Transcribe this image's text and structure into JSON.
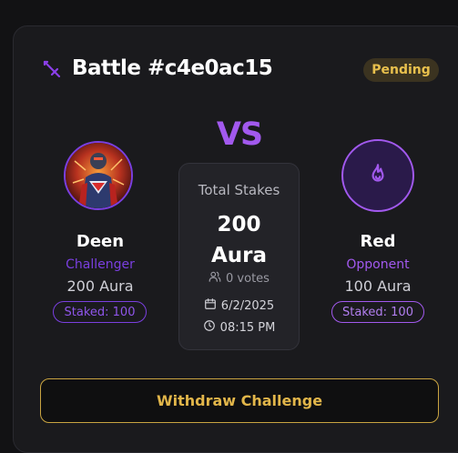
{
  "battle": {
    "title": "Battle #c4e0ac15",
    "status": "Pending",
    "vs_label": "VS"
  },
  "challenger": {
    "name": "Deen",
    "role": "Challenger",
    "aura": "200 Aura",
    "staked": "Staked: 100",
    "avatar_icon": "superhero-portrait"
  },
  "opponent": {
    "name": "Red",
    "role": "Opponent",
    "aura": "100 Aura",
    "staked": "Staked: 100",
    "avatar_icon": "flame-icon"
  },
  "stakes": {
    "label": "Total Stakes",
    "amount_value": "200",
    "amount_unit": "Aura",
    "votes": "0 votes",
    "date": "6/2/2025",
    "time": "08:15 PM"
  },
  "actions": {
    "withdraw_label": "Withdraw Challenge"
  },
  "colors": {
    "accent_purple": "#a259ee",
    "challenger_purple": "#7a3fe0",
    "pending_gold": "#e8c04d",
    "withdraw_gold": "#e2b64a"
  }
}
